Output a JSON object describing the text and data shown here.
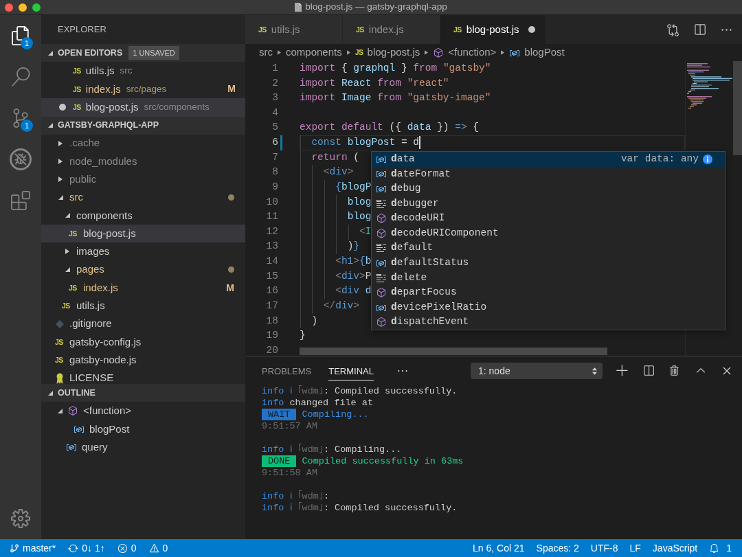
{
  "window": {
    "title": "blog-post.js — gatsby-graphql-app"
  },
  "activity_bar": {
    "items": [
      {
        "kind": "explorer",
        "selected": true,
        "badge": "1"
      },
      {
        "kind": "search",
        "selected": false
      },
      {
        "kind": "source_control",
        "selected": false,
        "badge": "1"
      },
      {
        "kind": "debug",
        "selected": false
      },
      {
        "kind": "extensions",
        "selected": false
      }
    ]
  },
  "sidebar": {
    "title": "EXPLORER",
    "open_editors": {
      "title": "OPEN EDITORS",
      "expanded": true,
      "badge": "1 UNSAVED",
      "items": [
        {
          "icon": "JS",
          "name": "utils.js",
          "path": "src",
          "modified": false,
          "dirty": false,
          "selected": false
        },
        {
          "icon": "JS",
          "name": "index.js",
          "path": "src/pages",
          "modified": true,
          "decoration": "M",
          "dirty": false,
          "selected": false
        },
        {
          "icon": "JS",
          "name": "blog-post.js",
          "path": "src/components",
          "modified": false,
          "dirty": true,
          "selected": true
        }
      ]
    },
    "folder": {
      "title": "GATSBY-GRAPHQL-APP",
      "expanded": true,
      "items": [
        {
          "kind": "folder",
          "label": ".cache",
          "expanded": false,
          "ignored": true,
          "modified": false,
          "selected": false
        },
        {
          "kind": "folder",
          "label": "node_modules",
          "expanded": false,
          "ignored": true,
          "modified": false,
          "selected": false
        },
        {
          "kind": "folder",
          "label": "public",
          "expanded": false,
          "ignored": true,
          "modified": false,
          "selected": false
        },
        {
          "kind": "folder",
          "label": "src",
          "expanded": true,
          "ignored": false,
          "modified": true,
          "selected": false,
          "children": [
            {
              "kind": "folder",
              "label": "components",
              "expanded": true,
              "ignored": false,
              "modified": false,
              "selected": false,
              "children": [
                {
                  "kind": "js",
                  "icon": "JS",
                  "label": "blog-post.js",
                  "ignored": false,
                  "modified": false,
                  "selected": true
                }
              ]
            },
            {
              "kind": "folder",
              "label": "images",
              "expanded": false,
              "ignored": false,
              "modified": false,
              "selected": false
            },
            {
              "kind": "folder",
              "label": "pages",
              "expanded": true,
              "ignored": false,
              "modified": true,
              "selected": false,
              "children": [
                {
                  "kind": "js",
                  "icon": "JS",
                  "label": "index.js",
                  "ignored": false,
                  "modified": true,
                  "decoration": "M",
                  "selected": false
                }
              ]
            },
            {
              "kind": "js",
              "icon": "JS",
              "label": "utils.js",
              "ignored": false,
              "modified": false,
              "selected": false
            }
          ]
        },
        {
          "kind": "git",
          "label": ".gitignore",
          "ignored": false,
          "modified": false,
          "selected": false
        },
        {
          "kind": "js",
          "icon": "JS",
          "label": "gatsby-config.js",
          "ignored": false,
          "modified": false,
          "selected": false
        },
        {
          "kind": "js",
          "icon": "JS",
          "label": "gatsby-node.js",
          "ignored": false,
          "modified": false,
          "selected": false
        },
        {
          "kind": "license",
          "label": "LICENSE",
          "ignored": false,
          "modified": false,
          "selected": false
        }
      ]
    },
    "outline": {
      "title": "OUTLINE",
      "expanded": true,
      "items": [
        {
          "kind": "function",
          "label": "<function>",
          "expanded": true,
          "children": [
            {
              "kind": "variable",
              "label": "blogPost"
            }
          ]
        },
        {
          "kind": "variable",
          "label": "query"
        }
      ]
    }
  },
  "editor": {
    "tabs": [
      {
        "icon": "JS",
        "label": "utils.js",
        "selected": false,
        "dirty": false
      },
      {
        "icon": "JS",
        "label": "index.js",
        "selected": false,
        "dirty": false
      },
      {
        "icon": "JS",
        "label": "blog-post.js",
        "selected": true,
        "dirty": true
      }
    ],
    "breadcrumbs": [
      {
        "kind": "folder",
        "label": "src"
      },
      {
        "kind": "folder",
        "label": "components"
      },
      {
        "kind": "js",
        "icon": "JS",
        "label": "blog-post.js"
      },
      {
        "kind": "function",
        "label": "<function>"
      },
      {
        "kind": "variable",
        "label": "blogPost"
      }
    ],
    "lines": [
      {
        "number": "1",
        "active": false,
        "modified": false,
        "tokens": [
          {
            "text": "import",
            "kind": "keyword"
          },
          {
            "text": " { ",
            "kind": "plain"
          },
          {
            "text": "graphql",
            "kind": "variable"
          },
          {
            "text": " } ",
            "kind": "plain"
          },
          {
            "text": "from ",
            "kind": "keyword"
          },
          {
            "text": "\"gatsby\"",
            "kind": "string"
          }
        ]
      },
      {
        "number": "2",
        "active": false,
        "modified": false,
        "tokens": [
          {
            "text": "import ",
            "kind": "keyword"
          },
          {
            "text": "React ",
            "kind": "variable"
          },
          {
            "text": "from ",
            "kind": "keyword"
          },
          {
            "text": "\"react\"",
            "kind": "string"
          }
        ]
      },
      {
        "number": "3",
        "active": false,
        "modified": false,
        "tokens": [
          {
            "text": "import ",
            "kind": "keyword"
          },
          {
            "text": "Image ",
            "kind": "variable"
          },
          {
            "text": "from ",
            "kind": "keyword"
          },
          {
            "text": "\"gatsby-image\"",
            "kind": "string"
          }
        ]
      },
      {
        "number": "4",
        "active": false,
        "modified": false
      },
      {
        "number": "5",
        "active": false,
        "modified": false,
        "tokens": [
          {
            "text": "export default ",
            "kind": "keyword"
          },
          {
            "text": "({ ",
            "kind": "plain"
          },
          {
            "text": "data",
            "kind": "variable"
          },
          {
            "text": " }) ",
            "kind": "plain"
          },
          {
            "text": "=>",
            "kind": "storage"
          },
          {
            "text": " {",
            "kind": "plain"
          }
        ]
      },
      {
        "number": "6",
        "active": true,
        "modified": true,
        "tokens": [
          {
            "text": "  const ",
            "kind": "storage"
          },
          {
            "text": "blogPost",
            "kind": "variable"
          },
          {
            "text": " = d",
            "kind": "plain"
          }
        ]
      },
      {
        "number": "7",
        "active": false,
        "modified": false,
        "tokens": [
          {
            "text": "  return ",
            "kind": "keyword"
          },
          {
            "text": "(",
            "kind": "plain"
          }
        ]
      },
      {
        "number": "8",
        "active": false,
        "modified": false,
        "tokens": [
          {
            "text": "    <",
            "kind": "tag_bracket"
          },
          {
            "text": "div",
            "kind": "tag"
          },
          {
            "text": ">",
            "kind": "tag_bracket"
          }
        ]
      },
      {
        "number": "9",
        "active": false,
        "modified": false,
        "tokens": [
          {
            "text": "      {",
            "kind": "storage"
          },
          {
            "text": "blogP",
            "kind": "variable"
          }
        ]
      },
      {
        "number": "10",
        "active": false,
        "modified": false,
        "tokens": [
          {
            "text": "        blog",
            "kind": "variable"
          }
        ]
      },
      {
        "number": "11",
        "active": false,
        "modified": false,
        "tokens": [
          {
            "text": "        blog",
            "kind": "variable"
          }
        ]
      },
      {
        "number": "12",
        "active": false,
        "modified": false,
        "tokens": [
          {
            "text": "          <",
            "kind": "tag_bracket"
          },
          {
            "text": "I",
            "kind": "component"
          }
        ]
      },
      {
        "number": "13",
        "active": false,
        "modified": false,
        "tokens": [
          {
            "text": "        )",
            "kind": "plain"
          },
          {
            "text": "}",
            "kind": "storage"
          }
        ]
      },
      {
        "number": "14",
        "active": false,
        "modified": false,
        "tokens": [
          {
            "text": "      <",
            "kind": "tag_bracket"
          },
          {
            "text": "h1",
            "kind": "tag"
          },
          {
            "text": ">",
            "kind": "tag_bracket"
          },
          {
            "text": "{",
            "kind": "storage"
          },
          {
            "text": "b",
            "kind": "variable"
          }
        ]
      },
      {
        "number": "15",
        "active": false,
        "modified": false,
        "tokens": [
          {
            "text": "      <",
            "kind": "tag_bracket"
          },
          {
            "text": "div",
            "kind": "tag"
          },
          {
            "text": ">",
            "kind": "tag_bracket"
          },
          {
            "text": "P",
            "kind": "plain"
          }
        ]
      },
      {
        "number": "16",
        "active": false,
        "modified": false,
        "tokens": [
          {
            "text": "      <",
            "kind": "tag_bracket"
          },
          {
            "text": "div",
            "kind": "tag"
          },
          {
            "text": " d",
            "kind": "variable"
          }
        ]
      },
      {
        "number": "17",
        "active": false,
        "modified": false,
        "tokens": [
          {
            "text": "    </",
            "kind": "tag_bracket"
          },
          {
            "text": "div",
            "kind": "tag"
          },
          {
            "text": ">",
            "kind": "tag_bracket"
          }
        ]
      },
      {
        "number": "18",
        "active": false,
        "modified": false,
        "tokens": [
          {
            "text": "  )",
            "kind": "plain"
          }
        ]
      },
      {
        "number": "19",
        "active": false,
        "modified": false,
        "tokens": [
          {
            "text": "}",
            "kind": "plain"
          }
        ]
      },
      {
        "number": "20",
        "active": false,
        "modified": false
      }
    ],
    "suggestions": {
      "items": [
        {
          "kind": "variable",
          "label": "**d**ata",
          "detail": "var data: any",
          "selected": true
        },
        {
          "kind": "variable",
          "label": "**d**ateFormat",
          "selected": false
        },
        {
          "kind": "variable",
          "label": "**d**ebug",
          "selected": false
        },
        {
          "kind": "keyword",
          "label": "**d**ebugger",
          "selected": false
        },
        {
          "kind": "function",
          "label": "**d**ecodeURI",
          "selected": false
        },
        {
          "kind": "function",
          "label": "**d**ecodeURIComponent",
          "selected": false
        },
        {
          "kind": "keyword",
          "label": "**d**efault",
          "selected": false
        },
        {
          "kind": "variable",
          "label": "**d**efaultStatus",
          "selected": false
        },
        {
          "kind": "keyword",
          "label": "**d**elete",
          "selected": false
        },
        {
          "kind": "function",
          "label": "**d**epartFocus",
          "selected": false
        },
        {
          "kind": "variable",
          "label": "**d**evicePixelRatio",
          "selected": false
        },
        {
          "kind": "function",
          "label": "**d**ispatchEvent",
          "selected": false
        }
      ]
    }
  },
  "panel": {
    "tabs": [
      {
        "label": "PROBLEMS",
        "selected": false
      },
      {
        "label": "TERMINAL",
        "selected": true
      }
    ],
    "terminal_picker": "1: node",
    "terminal": {
      "blocks": [
        [
          [
            {
              "text": "info ℹ ",
              "kind": "info"
            },
            {
              "text": "｢wdm｣",
              "kind": "dim"
            },
            {
              "text": ": Compiled successfully.",
              "kind": "text"
            }
          ],
          [
            {
              "text": "info",
              "kind": "info"
            },
            {
              "text": " changed file at",
              "kind": "text"
            }
          ],
          [
            {
              "text": "WAIT",
              "kind": "wait_badge"
            },
            {
              "text": "Compiling...",
              "kind": "blue"
            }
          ],
          [
            {
              "text": "9:51:57 AM",
              "kind": "time"
            }
          ]
        ],
        [
          [
            {
              "text": "info ℹ ",
              "kind": "info"
            },
            {
              "text": "｢wdm｣",
              "kind": "dim"
            },
            {
              "text": ": Compiling...",
              "kind": "text"
            }
          ],
          [
            {
              "text": "DONE",
              "kind": "done_badge"
            },
            {
              "text": "Compiled successfully in 63ms",
              "kind": "green"
            }
          ],
          [
            {
              "text": "9:51:58 AM",
              "kind": "time"
            }
          ]
        ],
        [
          [
            {
              "text": "info ℹ ",
              "kind": "info"
            },
            {
              "text": "｢wdm｣",
              "kind": "dim"
            },
            {
              "text": ":",
              "kind": "text"
            }
          ],
          [
            {
              "text": "info ℹ ",
              "kind": "info"
            },
            {
              "text": "｢wdm｣",
              "kind": "dim"
            },
            {
              "text": ": Compiled successfully.",
              "kind": "text"
            }
          ]
        ]
      ]
    }
  },
  "status_bar": {
    "left": [
      {
        "kind": "branch",
        "text": "master*"
      },
      {
        "kind": "sync",
        "text": "0↓ 1↑"
      },
      {
        "kind": "errors",
        "text": "0"
      },
      {
        "kind": "warnings",
        "text": "0"
      }
    ],
    "right": [
      {
        "kind": "text",
        "text": "Ln 6, Col 21"
      },
      {
        "kind": "text",
        "text": "Spaces: 2"
      },
      {
        "kind": "text",
        "text": "UTF-8"
      },
      {
        "kind": "text",
        "text": "LF"
      },
      {
        "kind": "text",
        "text": "JavaScript"
      },
      {
        "kind": "bell",
        "text": "1"
      }
    ]
  }
}
